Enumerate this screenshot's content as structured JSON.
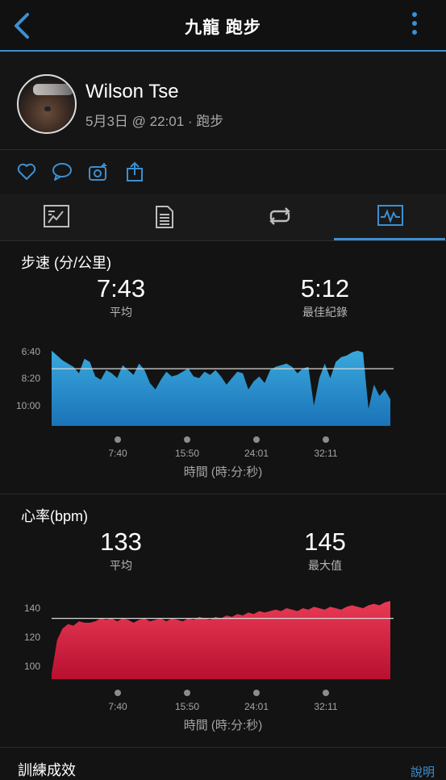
{
  "header": {
    "title": "九龍 跑步"
  },
  "profile": {
    "name": "Wilson Tse",
    "meta": "5月3日 @ 22:01 · 跑步"
  },
  "actions": [
    "heart-icon",
    "comment-icon",
    "camera-add-icon",
    "share-icon"
  ],
  "tabs": [
    "summary-tab",
    "details-tab",
    "laps-tab",
    "charts-tab"
  ],
  "active_tab": 3,
  "colors": {
    "accent": "#3d8fd1",
    "pace_fill_top": "#3aa8dc",
    "pace_fill_bottom": "#1a73b8",
    "hr_fill_top": "#e83a55",
    "hr_fill_bottom": "#b81030"
  },
  "pace": {
    "label": "步速 (分/公里)",
    "avg_value": "7:43",
    "avg_label": "平均",
    "best_value": "5:12",
    "best_label": "最佳紀錄",
    "y_ticks": [
      "6:40",
      "8:20",
      "10:00"
    ],
    "x_ticks": [
      "7:40",
      "15:50",
      "24:01",
      "32:11"
    ],
    "x_axis": "時間 (時:分:秒)"
  },
  "heart_rate": {
    "label": "心率(bpm)",
    "avg_value": "133",
    "avg_label": "平均",
    "max_value": "145",
    "max_label": "最大值",
    "y_ticks": [
      "140",
      "120",
      "100"
    ],
    "x_ticks": [
      "7:40",
      "15:50",
      "24:01",
      "32:11"
    ],
    "x_axis": "時間 (時:分:秒)"
  },
  "footer": {
    "section": "訓練成效",
    "help": "說明"
  },
  "chart_data": [
    {
      "type": "area",
      "name": "pace",
      "yaxis": "pace min/km (inverted)",
      "y_avg": "7:43",
      "y_ticks": [
        "6:40",
        "8:20",
        "10:00"
      ],
      "x_ticks": [
        "7:40",
        "15:50",
        "24:01",
        "32:11"
      ],
      "values": [
        6.6,
        6.9,
        7.2,
        7.4,
        7.6,
        8.0,
        7.1,
        7.3,
        8.2,
        8.4,
        7.8,
        8.0,
        8.3,
        7.5,
        7.8,
        8.1,
        7.4,
        7.8,
        8.6,
        9.0,
        8.4,
        7.9,
        8.2,
        8.1,
        7.9,
        7.7,
        8.2,
        8.3,
        7.9,
        8.1,
        7.8,
        8.2,
        8.7,
        8.3,
        7.9,
        8.0,
        9.0,
        8.5,
        8.2,
        8.6,
        7.8,
        7.6,
        7.5,
        7.4,
        7.6,
        8.0,
        7.7,
        7.6,
        10.0,
        8.3,
        7.4,
        8.3,
        7.3,
        7.0,
        6.9,
        6.7,
        6.6,
        6.7,
        10.2,
        8.7,
        9.4,
        9.0,
        9.6
      ]
    },
    {
      "type": "area",
      "name": "heart_rate",
      "yaxis": "bpm",
      "y_avg": 133,
      "y_ticks": [
        140,
        120,
        100
      ],
      "x_ticks": [
        "7:40",
        "15:50",
        "24:01",
        "32:11"
      ],
      "values": [
        95,
        118,
        126,
        129,
        128,
        131,
        130,
        130,
        131,
        133,
        132,
        133,
        131,
        133,
        132,
        130,
        132,
        133,
        131,
        132,
        133,
        131,
        133,
        132,
        131,
        133,
        132,
        134,
        133,
        132,
        134,
        133,
        135,
        134,
        136,
        135,
        137,
        136,
        138,
        137,
        138,
        139,
        138,
        140,
        139,
        138,
        140,
        139,
        141,
        140,
        139,
        141,
        140,
        139,
        141,
        142,
        141,
        140,
        142,
        143,
        142,
        144,
        145
      ]
    }
  ]
}
